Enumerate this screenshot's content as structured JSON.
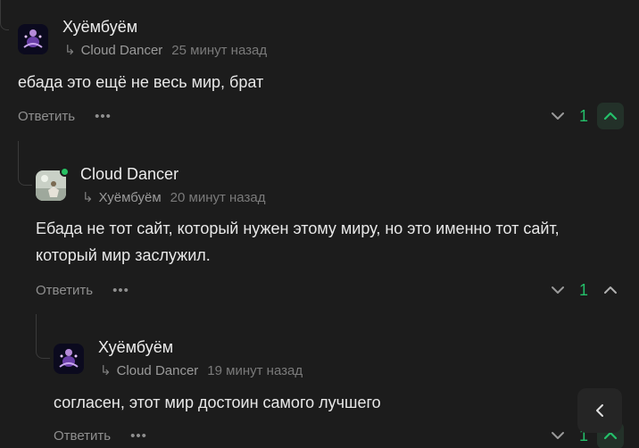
{
  "comments": [
    {
      "author": "Хуёмбуём",
      "reply_to": "Cloud Dancer",
      "time": "25 минут назад",
      "text_lines": [
        "ебада это ещё не весь мир, брат"
      ],
      "reply_label": "Ответить",
      "more_label": "•••",
      "score": "1",
      "upvoted": true
    },
    {
      "author": "Cloud Dancer",
      "reply_to": "Хуёмбуём",
      "time": "20 минут назад",
      "text_lines": [
        "Ебада не тот сайт, который нужен этому миру, но это именно тот сайт,",
        "который мир заслужил."
      ],
      "reply_label": "Ответить",
      "more_label": "•••",
      "score": "1",
      "upvoted": false,
      "online": true
    },
    {
      "author": "Хуёмбуём",
      "reply_to": "Cloud Dancer",
      "time": "19 минут назад",
      "text_lines": [
        "согласен, этот мир достоин самого лучшего"
      ],
      "reply_label": "Ответить",
      "more_label": "•••",
      "score": "1",
      "upvoted": true
    }
  ],
  "reply_arrow_glyph": "↳",
  "icons": {
    "vote_down": "chevron-down-icon",
    "vote_up": "chevron-up-icon",
    "float": "chevron-left-icon"
  },
  "colors": {
    "background": "#1c1c1c",
    "score": "#24c06a",
    "upvote_active": "#24c06a",
    "upvote_active_bg": "#233129",
    "muted": "#8f8f8f",
    "online": "#27c062"
  }
}
